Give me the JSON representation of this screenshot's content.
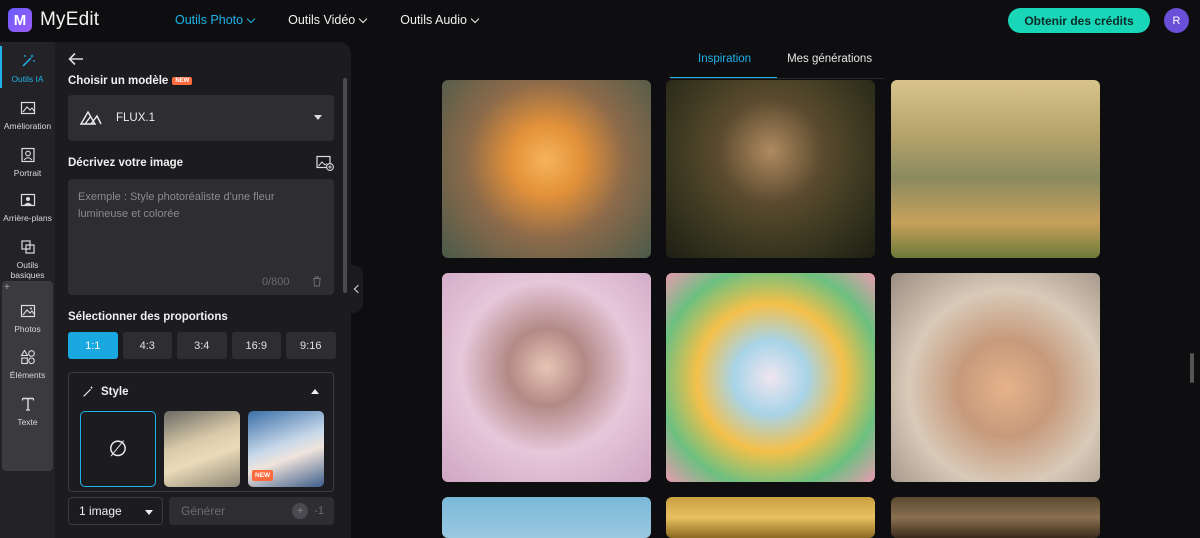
{
  "app": {
    "name": "MyEdit",
    "logo_letter": "M"
  },
  "nav": {
    "items": [
      {
        "label": "Outils Photo",
        "active": true
      },
      {
        "label": "Outils Vidéo",
        "active": false
      },
      {
        "label": "Outils Audio",
        "active": false
      }
    ],
    "credits_button": "Obtenir des crédits",
    "avatar_letter": "R"
  },
  "rail": {
    "items": [
      {
        "label": "Outils IA",
        "icon": "magic-wand-icon",
        "active": true
      },
      {
        "label": "Amélioration",
        "icon": "image-enhance-icon"
      },
      {
        "label": "Portrait",
        "icon": "portrait-icon"
      },
      {
        "label": "Arrière-plans",
        "icon": "background-icon"
      },
      {
        "label": "Outils basiques",
        "icon": "basic-tools-icon"
      },
      {
        "label": "Photos",
        "icon": "photos-icon"
      },
      {
        "label": "Éléments",
        "icon": "elements-icon"
      },
      {
        "label": "Texte",
        "icon": "text-icon"
      }
    ],
    "plus": "+"
  },
  "panel": {
    "model_label": "Choisir un modèle",
    "model_new_badge": "NEW",
    "model_value": "FLUX.1",
    "prompt_label": "Décrivez votre image",
    "prompt_placeholder": "Exemple : Style photoréaliste d'une fleur lumineuse et colorée",
    "prompt_counter": "0/800",
    "ratio_label": "Sélectionner des proportions",
    "ratios": [
      {
        "label": "1:1",
        "active": true
      },
      {
        "label": "4:3",
        "active": false
      },
      {
        "label": "3:4",
        "active": false
      },
      {
        "label": "16:9",
        "active": false
      },
      {
        "label": "9:16",
        "active": false
      }
    ],
    "style_label": "Style",
    "style_none_symbol": "∅",
    "style_new_tag": "NEW",
    "count_value": "1 image",
    "generate_label": "Générer",
    "generate_cost": "-1",
    "coin_symbol": "+"
  },
  "main": {
    "tabs": [
      {
        "label": "Inspiration",
        "active": true
      },
      {
        "label": "Mes générations",
        "active": false
      }
    ]
  },
  "colors": {
    "accent": "#1fb3ea",
    "credits_button": "#19d6b8",
    "new_badge": "#ff6b3d",
    "background": "#0e0e10",
    "panel": "#1c1c20"
  }
}
